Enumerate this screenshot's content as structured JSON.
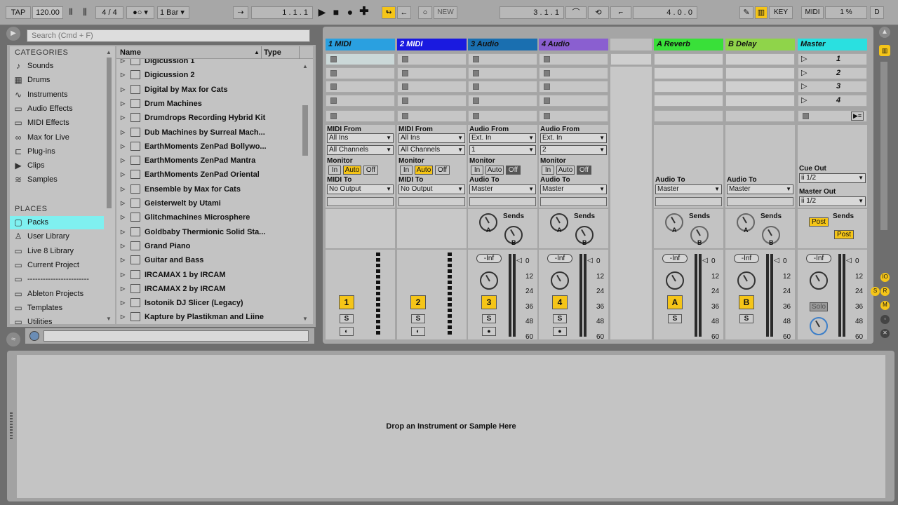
{
  "transport": {
    "tap": "TAP",
    "tempo": "120.00",
    "signature": "4 / 4",
    "quantize": "1 Bar",
    "position": "1 .  1 .  1",
    "new": "NEW",
    "loop_start": "3 .  1 .  1",
    "loop_length": "4 .  0 .  0",
    "key": "KEY",
    "midi": "MIDI",
    "cpu": "1 %",
    "disk": "D"
  },
  "browser": {
    "search_placeholder": "Search (Cmd + F)",
    "categories_title": "CATEGORIES",
    "categories": [
      {
        "label": "Sounds",
        "icon": "note-icon"
      },
      {
        "label": "Drums",
        "icon": "grid-icon"
      },
      {
        "label": "Instruments",
        "icon": "wave-icon"
      },
      {
        "label": "Audio Effects",
        "icon": "fx-icon"
      },
      {
        "label": "MIDI Effects",
        "icon": "midi-fx-icon"
      },
      {
        "label": "Max for Live",
        "icon": "max-icon"
      },
      {
        "label": "Plug-ins",
        "icon": "plug-icon"
      },
      {
        "label": "Clips",
        "icon": "play-box-icon"
      },
      {
        "label": "Samples",
        "icon": "waveform-icon"
      }
    ],
    "places_title": "PLACES",
    "places": [
      {
        "label": "Packs",
        "icon": "box-icon",
        "selected": true
      },
      {
        "label": "User Library",
        "icon": "user-icon"
      },
      {
        "label": "Live 8 Library",
        "icon": "folder-icon"
      },
      {
        "label": "Current Project",
        "icon": "folder-icon"
      },
      {
        "label": "------------------------",
        "icon": "folder-icon"
      },
      {
        "label": "Ableton Projects",
        "icon": "folder-icon"
      },
      {
        "label": "Templates",
        "icon": "folder-icon"
      },
      {
        "label": "Utilities",
        "icon": "folder-icon"
      }
    ],
    "col_name": "Name",
    "col_type": "Type",
    "files": [
      "Digicussion 1",
      "Digicussion 2",
      "Digital by Max for Cats",
      "Drum Machines",
      "Drumdrops Recording Hybrid Kit",
      "Dub Machines by Surreal Mach...",
      "EarthMoments ZenPad Bollywo...",
      "EarthMoments ZenPad Mantra",
      "EarthMoments ZenPad Oriental",
      "Ensemble by Max for Cats",
      "Geisterwelt by Utami",
      "Glitchmachines Microsphere",
      "Goldbaby Thermionic Solid Sta...",
      "Grand Piano",
      "Guitar and Bass",
      "IRCAMAX 1 by IRCAM",
      "IRCAMAX 2 by IRCAM",
      "Isotonik DJ Slicer (Legacy)",
      "Kapture by Plastikman and Liine"
    ]
  },
  "colors": {
    "midi1": "#2aa0e0",
    "midi2": "#1a1ae0",
    "audio3": "#1a6fb0",
    "audio4": "#8a5fd0",
    "reverb": "#39e039",
    "delay": "#8fd44a",
    "master": "#2ae0e0",
    "accent": "#f5c518",
    "packs": "#7ff0f0"
  },
  "tracks": [
    {
      "title": "1 MIDI",
      "from_label": "MIDI From",
      "from": "All Ins",
      "channel": "All Channels",
      "to_label": "MIDI To",
      "to": "No Output",
      "num": "1"
    },
    {
      "title": "2 MIDI",
      "from_label": "MIDI From",
      "from": "All Ins",
      "channel": "All Channels",
      "to_label": "MIDI To",
      "to": "No Output",
      "num": "2"
    },
    {
      "title": "3 Audio",
      "from_label": "Audio From",
      "from": "Ext. In",
      "channel": "1",
      "to_label": "Audio To",
      "to": "Master",
      "num": "3",
      "vol": "-Inf"
    },
    {
      "title": "4 Audio",
      "from_label": "Audio From",
      "from": "Ext. In",
      "channel": "2",
      "to_label": "Audio To",
      "to": "Master",
      "num": "4",
      "vol": "-Inf"
    }
  ],
  "returns": [
    {
      "title": "A Reverb",
      "to_label": "Audio To",
      "to": "Master",
      "btn": "A",
      "vol": "-Inf"
    },
    {
      "title": "B Delay",
      "to_label": "Audio To",
      "to": "Master",
      "btn": "B",
      "vol": "-Inf"
    }
  ],
  "master": {
    "title": "Master",
    "scenes": [
      "1",
      "2",
      "3",
      "4"
    ],
    "cue_label": "Cue Out",
    "cue": "ii 1/2",
    "out_label": "Master Out",
    "out": "ii 1/2",
    "post": "Post",
    "solo": "Solo",
    "vol": "-Inf"
  },
  "mixer": {
    "monitor": "Monitor",
    "in": "In",
    "auto": "Auto",
    "off": "Off",
    "sends": "Sends",
    "s": "S",
    "knob_a": "A",
    "knob_b": "B",
    "scale": [
      "0",
      "12",
      "24",
      "36",
      "48",
      "60"
    ]
  },
  "detail": {
    "drop_text": "Drop an Instrument or Sample Here"
  }
}
